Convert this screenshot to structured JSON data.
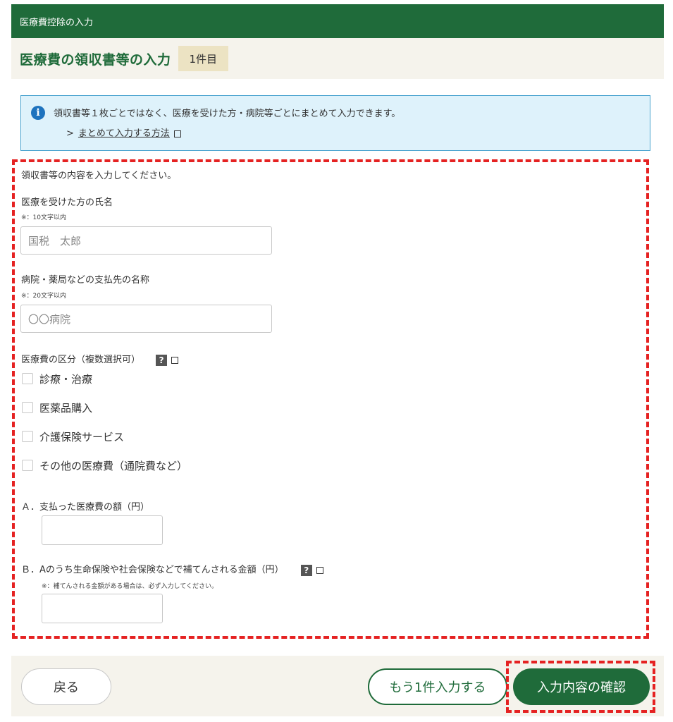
{
  "header": {
    "section_title": "医療費控除の入力",
    "page_title": "医療費の領収書等の入力",
    "count_badge": "1件目"
  },
  "info": {
    "message": "領収書等１枚ごとではなく、医療を受けた方・病院等ごとにまとめて入力できます。",
    "link_prefix": ">",
    "link_text": "まとめて入力する方法"
  },
  "form": {
    "intro": "領収書等の内容を入力してください。",
    "patient": {
      "label": "医療を受けた方の氏名",
      "note": "※：10文字以内",
      "placeholder": "国税　太郎"
    },
    "payee": {
      "label": "病院・薬局などの支払先の名称",
      "note": "※：20文字以内",
      "placeholder": "〇〇病院"
    },
    "category": {
      "label": "医療費の区分（複数選択可）",
      "help_glyph": "?",
      "options": [
        "診療・治療",
        "医薬品購入",
        "介護保険サービス",
        "その他の医療費（通院費など）"
      ]
    },
    "amount_a": {
      "label": "Ａ．支払った医療費の額（円）"
    },
    "amount_b": {
      "label": "Ｂ．Aのうち生命保険や社会保険などで補てんされる金額（円）",
      "help_glyph": "?",
      "note": "※：補てんされる金額がある場合は、必ず入力してください。"
    }
  },
  "footer": {
    "back_label": "戻る",
    "add_another_label": "もう1件入力する",
    "confirm_label": "入力内容の確認"
  },
  "colors": {
    "brand_green": "#1f6b3a",
    "highlight_red": "#e52222",
    "info_bg": "#def2fb"
  }
}
